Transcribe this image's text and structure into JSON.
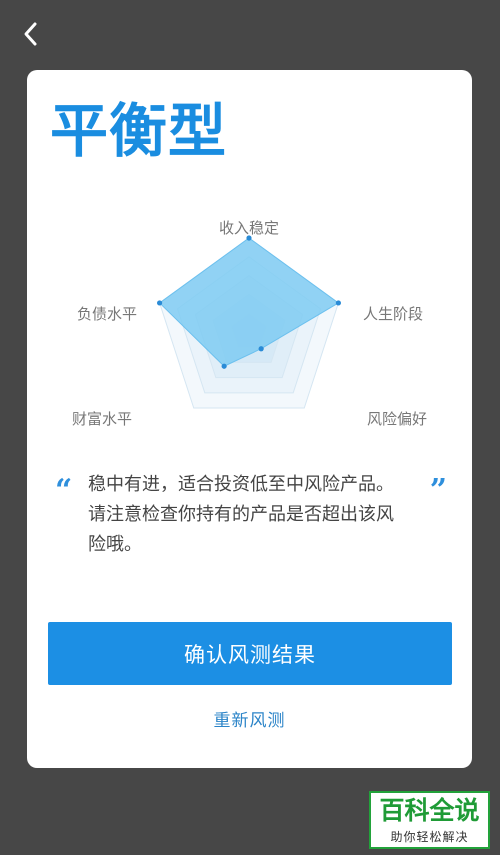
{
  "nav": {
    "back_icon": "chevron-left-icon"
  },
  "result": {
    "title": "平衡型",
    "radar": {
      "axes": [
        "收入稳定",
        "人生阶段",
        "风险偏好",
        "财富水平",
        "负债水平"
      ],
      "values": [
        1.0,
        1.0,
        0.22,
        0.45,
        1.0
      ],
      "fill_color": "#7fcbf2",
      "point_color": "#2a8bd6"
    },
    "quote": {
      "open": "“",
      "close": "”",
      "text": "稳中有进，适合投资低至中风险产品。请注意检查你持有的产品是否超出该风险哦。"
    },
    "confirm_label": "确认风测结果",
    "retest_label": "重新风测"
  },
  "watermark": {
    "main": "百科全说",
    "sub": "助你轻松解决"
  },
  "colors": {
    "background": "#474747",
    "accent": "#1a8de0",
    "button": "#1c8fe4"
  }
}
